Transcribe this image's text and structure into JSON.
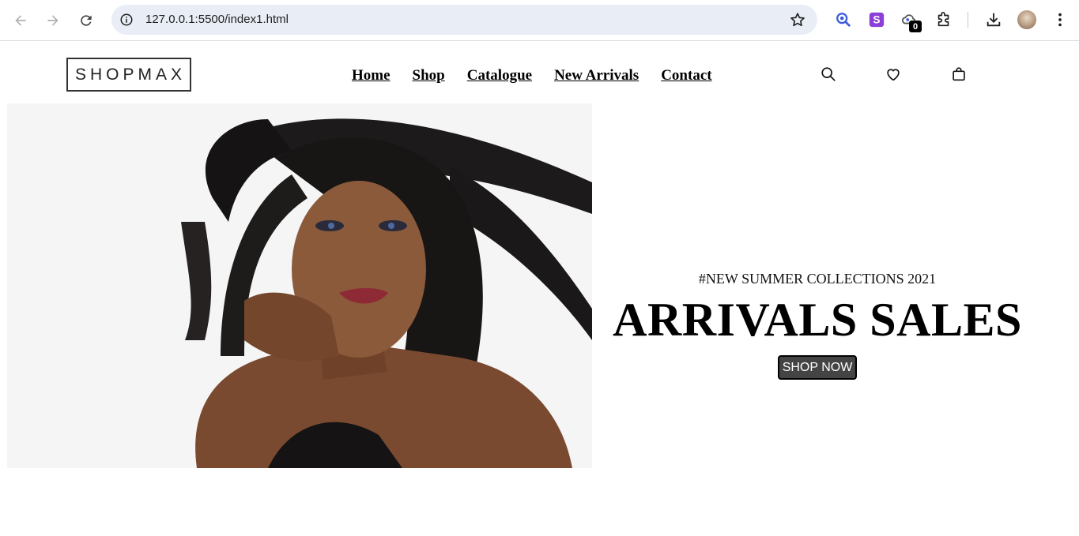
{
  "browser": {
    "url": "127.0.0.1:5500/index1.html",
    "extension_badge": "0",
    "icons": [
      "back-icon",
      "forward-icon",
      "reload-icon",
      "info-icon",
      "bookmark-star-icon",
      "lens-extension-icon",
      "s-extension-icon",
      "cloud-extension-icon",
      "puzzle-icon",
      "download-icon",
      "more-vert-icon"
    ]
  },
  "site": {
    "logo": "SHOPMAX",
    "nav": [
      "Home",
      "Shop",
      "Catalogue",
      "New Arrivals",
      "Contact"
    ],
    "icons": [
      "search-icon",
      "heart-icon",
      "bag-icon"
    ]
  },
  "hero": {
    "tagline": "#NEW SUMMER COLLECTIONS 2021",
    "headline": "ARRIVALS SALES",
    "cta": "SHOP NOW"
  },
  "colors": {
    "button_bg": "#444444",
    "omnibox_bg": "#e9eef6",
    "hero_bg": "#f5f5f5"
  }
}
